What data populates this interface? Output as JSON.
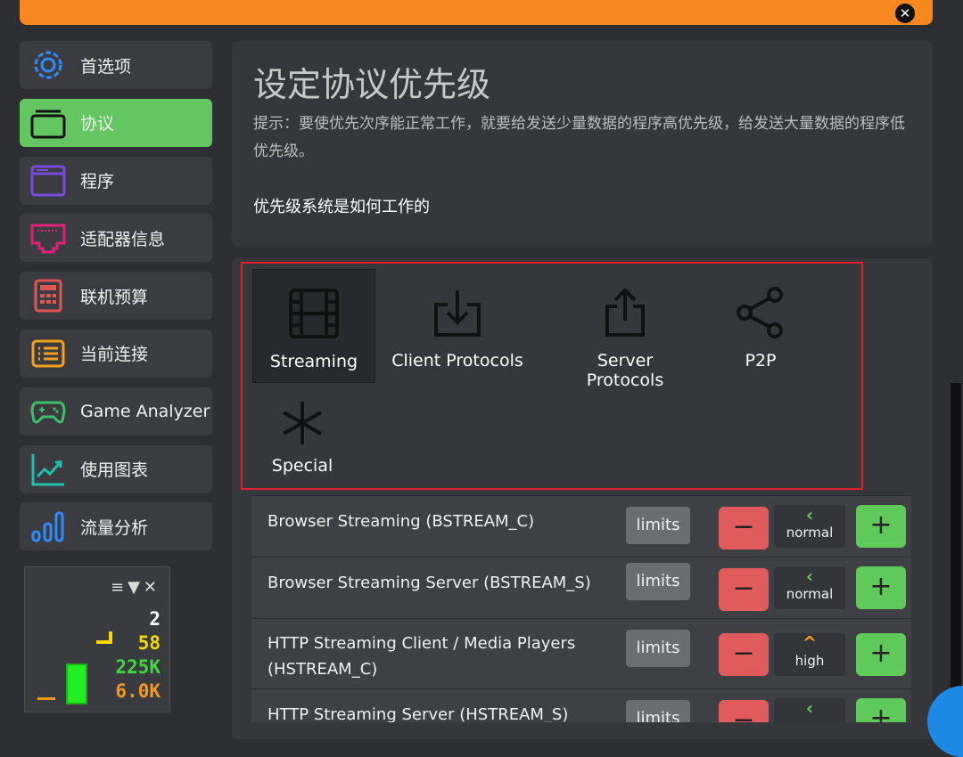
{
  "sidebar": {
    "items": [
      {
        "label": "首选项",
        "icon": "gear-icon"
      },
      {
        "label": "协议",
        "icon": "layers-icon"
      },
      {
        "label": "程序",
        "icon": "window-icon"
      },
      {
        "label": "适配器信息",
        "icon": "ethernet-icon"
      },
      {
        "label": "联机预算",
        "icon": "calculator-icon"
      },
      {
        "label": "当前连接",
        "icon": "list-icon"
      },
      {
        "label": "Game Analyzer",
        "icon": "gamepad-icon"
      },
      {
        "label": "使用图表",
        "icon": "line-chart-icon"
      },
      {
        "label": "流量分析",
        "icon": "bar-chart-icon"
      }
    ],
    "active_index": 1
  },
  "mini_widget": {
    "count": "2",
    "upload": "58",
    "download": "225K",
    "total": "6.0K",
    "colors": {
      "count": "#ffffff",
      "upload": "#f5d800",
      "download": "#3fd83f",
      "total": "#f29a1f"
    }
  },
  "header": {
    "title": "设定协议优先级",
    "tip": "提示：要使优先次序能正常工作，就要给发送少量数据的程序高优先级，给发送大量数据的程序低优先级。",
    "how_link": "优先级系统是如何工作的"
  },
  "categories": [
    {
      "label": "Streaming",
      "icon": "film-icon",
      "selected": true
    },
    {
      "label": "Client Protocols",
      "icon": "download-icon",
      "selected": false
    },
    {
      "label": "Server Protocols",
      "icon": "upload-icon",
      "selected": false
    },
    {
      "label": "P2P",
      "icon": "share-icon",
      "selected": false
    },
    {
      "label": "Special",
      "icon": "asterisk-icon",
      "selected": false
    }
  ],
  "rows": [
    {
      "name": "Browser Streaming (BSTREAM_C)",
      "limits": "limits",
      "priority": "normal"
    },
    {
      "name": "Browser Streaming Server (BSTREAM_S)",
      "limits": "limits",
      "priority": "normal"
    },
    {
      "name": "HTTP Streaming Client / Media Players (HSTREAM_C)",
      "limits": "limits",
      "priority": "high"
    },
    {
      "name": "HTTP Streaming Server (HSTREAM_S)",
      "limits": "limits",
      "priority": ""
    }
  ],
  "buttons": {
    "minus": "−",
    "plus": "+"
  },
  "colors": {
    "accent": "#63c660",
    "topbar": "#f7881f",
    "minus": "#e05c5c",
    "plus": "#5fca5a",
    "highlight_box": "#e0202a"
  }
}
